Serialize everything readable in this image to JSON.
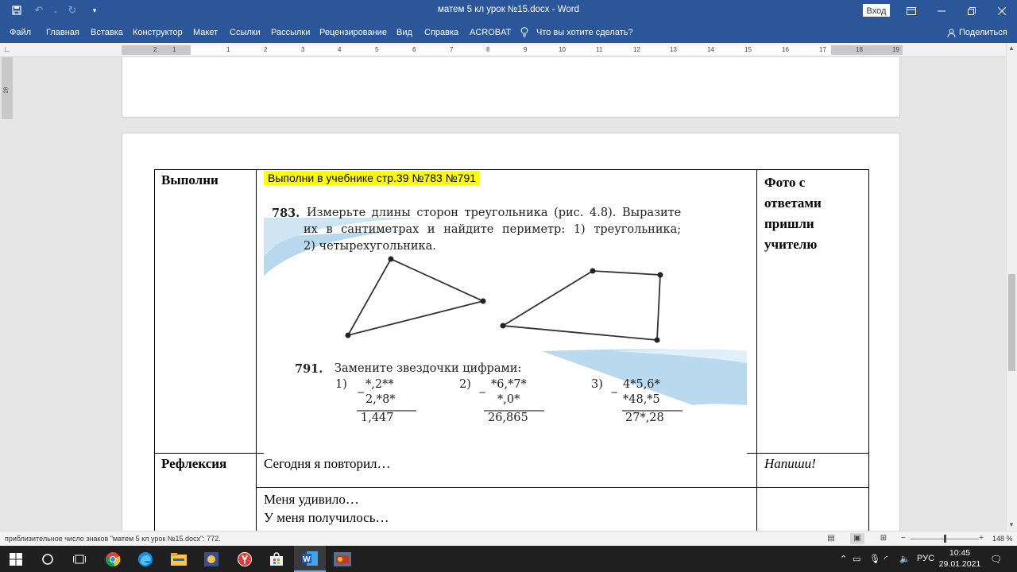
{
  "window": {
    "title": "матем 5 кл урок №15.docx  -  Word",
    "signin_label": "Вход"
  },
  "menu": {
    "tabs": [
      "Файл",
      "Главная",
      "Вставка",
      "Конструктор",
      "Макет",
      "Ссылки",
      "Рассылки",
      "Рецензирование",
      "Вид",
      "Справка",
      "ACROBAT"
    ],
    "tell_me": "Что вы хотите сделать?",
    "share": "Поделиться"
  },
  "ruler": {
    "left_labels": [
      "2",
      "1"
    ],
    "labels": [
      "1",
      "2",
      "3",
      "4",
      "5",
      "6",
      "7",
      "8",
      "9",
      "10",
      "11",
      "12",
      "13",
      "14",
      "15",
      "16",
      "17",
      "18",
      "19"
    ],
    "vertical_label": "28"
  },
  "table": {
    "row1": {
      "label": "Выполни",
      "highlight": "Выполни в учебнике стр.39 №783 №791",
      "side": [
        "Фото с",
        "ответами",
        "пришли",
        "учителю"
      ]
    },
    "row2": {
      "label": "Рефлексия",
      "text": "Сегодня я повторил…",
      "side": "Напиши!"
    },
    "row3": {
      "lines": [
        "Меня удивило…",
        "У меня получилось…"
      ]
    }
  },
  "textbook": {
    "p783": {
      "num": "783.",
      "line1": "Измерьте длины сторон треугольника (рис. 4.8). Выразите",
      "line2": "их в сантиметрах и найдите периметр: 1) треугольника;",
      "line3": "2) четырехугольника."
    },
    "p791": {
      "num": "791.",
      "title": "Замените звездочки цифрами:",
      "ex1": {
        "n": "1)",
        "a": "*,2**",
        "b": "2,*8*",
        "r": "1,447"
      },
      "ex2": {
        "n": "2)",
        "a": "*6,*7*",
        "b": "*,0*",
        "r": "26,865"
      },
      "ex3": {
        "n": "3)",
        "a": "4*5,6*",
        "b": "*48,*5",
        "r": "27*,28"
      },
      "minus": "−"
    }
  },
  "status": {
    "text": "приблизительное число знаков \"матем 5 кл урок №15.docx\": 772.",
    "zoom": "148 %"
  },
  "tray": {
    "lang": "РУС",
    "time": "10:45",
    "date": "29.01.2021"
  }
}
